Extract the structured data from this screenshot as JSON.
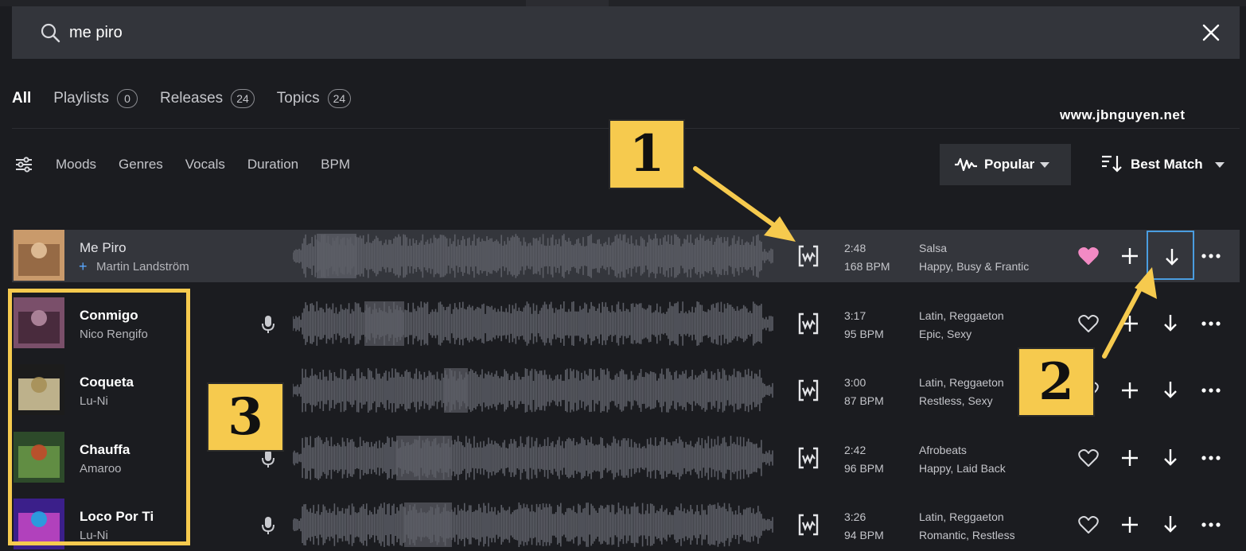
{
  "search": {
    "value": "me piro"
  },
  "tabs": [
    {
      "label": "All",
      "count": null
    },
    {
      "label": "Playlists",
      "count": "0"
    },
    {
      "label": "Releases",
      "count": "24"
    },
    {
      "label": "Topics",
      "count": "24"
    }
  ],
  "watermark": "www.jbnguyen.net",
  "filters": [
    "Moods",
    "Genres",
    "Vocals",
    "Duration",
    "BPM"
  ],
  "sort": {
    "popular_label": "Popular",
    "order_label": "Best Match"
  },
  "tracks": [
    {
      "title": "Me Piro",
      "artist": "Martin Landström",
      "duration": "2:48",
      "bpm": "168 BPM",
      "genre": "Salsa",
      "mood": "Happy, Busy & Frantic",
      "liked": true,
      "vocals": false
    },
    {
      "title": "Conmigo",
      "artist": "Nico Rengifo",
      "duration": "3:17",
      "bpm": "95 BPM",
      "genre": "Latin, Reggaeton",
      "mood": "Epic, Sexy",
      "liked": false,
      "vocals": true
    },
    {
      "title": "Coqueta",
      "artist": "Lu-Ni",
      "duration": "3:00",
      "bpm": "87 BPM",
      "genre": "Latin, Reggaeton",
      "mood": "Restless, Sexy",
      "liked": false,
      "vocals": false
    },
    {
      "title": "Chauffa",
      "artist": "Amaroo",
      "duration": "2:42",
      "bpm": "96 BPM",
      "genre": "Afrobeats",
      "mood": "Happy, Laid Back",
      "liked": false,
      "vocals": true
    },
    {
      "title": "Loco Por Ti",
      "artist": "Lu-Ni",
      "duration": "3:26",
      "bpm": "94 BPM",
      "genre": "Latin, Reggaeton",
      "mood": "Romantic, Restless",
      "liked": false,
      "vocals": true
    }
  ],
  "annotations": [
    "1",
    "2",
    "3"
  ],
  "colors": {
    "background": "#1b1c20",
    "selected_row": "#34363c",
    "heart_liked": "#f28ac4",
    "annotation": "#f6ca4e",
    "focus": "#4a9de0"
  }
}
